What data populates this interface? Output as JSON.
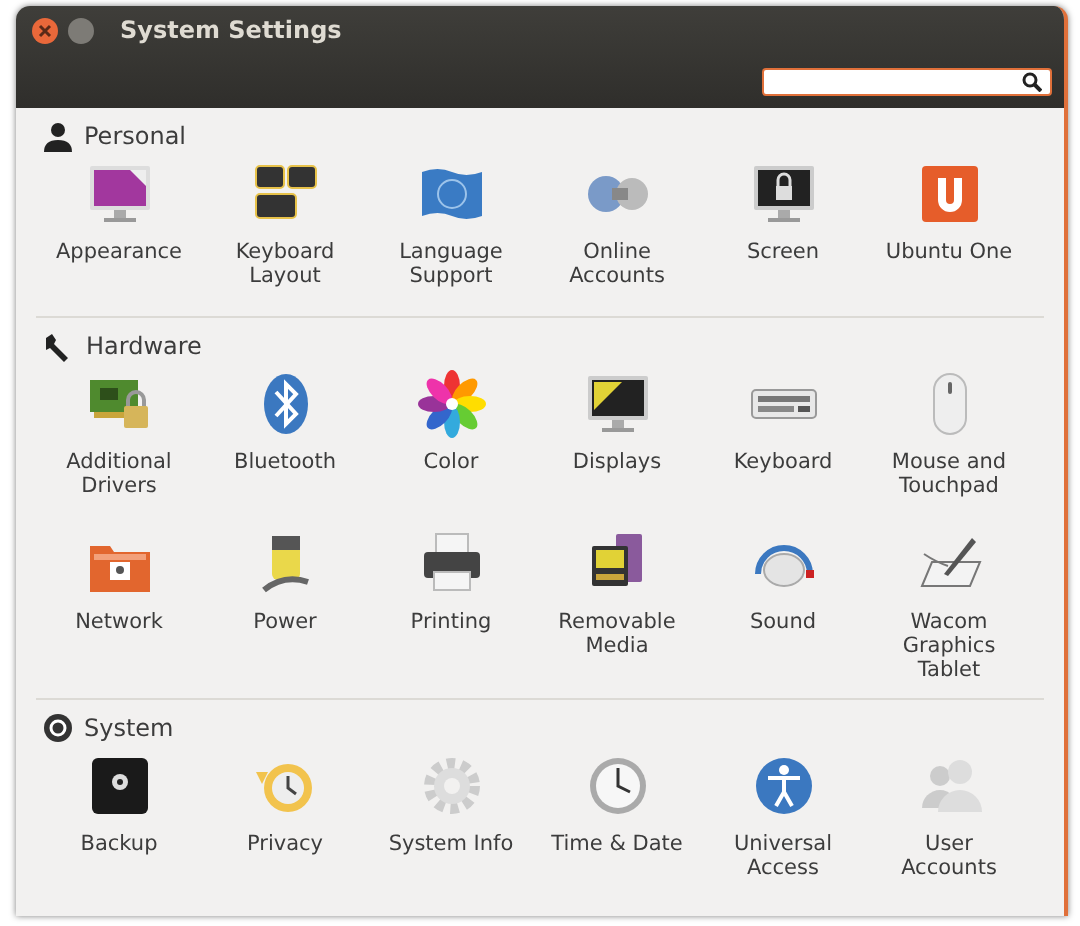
{
  "window": {
    "title": "System Settings"
  },
  "sections": [
    {
      "kind": "personal",
      "title": "Personal",
      "items": [
        {
          "label": "Appearance"
        },
        {
          "label": "Keyboard\nLayout"
        },
        {
          "label": "Language\nSupport"
        },
        {
          "label": "Online\nAccounts"
        },
        {
          "label": "Screen"
        },
        {
          "label": "Ubuntu One"
        }
      ]
    },
    {
      "kind": "hardware",
      "title": "Hardware",
      "items": [
        {
          "label": "Additional\nDrivers"
        },
        {
          "label": "Bluetooth"
        },
        {
          "label": "Color"
        },
        {
          "label": "Displays"
        },
        {
          "label": "Keyboard"
        },
        {
          "label": "Mouse and\nTouchpad"
        },
        {
          "label": "Network"
        },
        {
          "label": "Power"
        },
        {
          "label": "Printing"
        },
        {
          "label": "Removable\nMedia"
        },
        {
          "label": "Sound"
        },
        {
          "label": "Wacom\nGraphics\nTablet"
        }
      ]
    },
    {
      "kind": "system",
      "title": "System",
      "items": [
        {
          "label": "Backup"
        },
        {
          "label": "Privacy"
        },
        {
          "label": "System Info"
        },
        {
          "label": "Time & Date"
        },
        {
          "label": "Universal\nAccess"
        },
        {
          "label": "User\nAccounts"
        }
      ]
    }
  ]
}
